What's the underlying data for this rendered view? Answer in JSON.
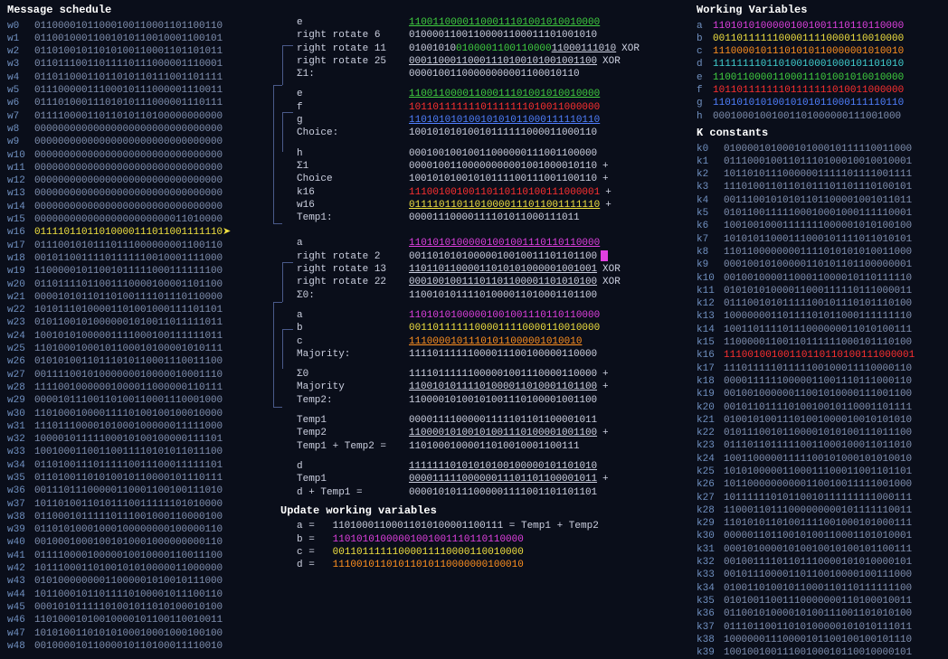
{
  "sections": {
    "message_schedule": "Message schedule",
    "working_vars": "Working Variables",
    "k_constants": "K constants",
    "update": "Update working variables"
  },
  "message_schedule": [
    {
      "label": "w0",
      "bits": "01100001011000100110001101100110"
    },
    {
      "label": "w1",
      "bits": "01100100011001010110010001100101"
    },
    {
      "label": "w2",
      "bits": "01101001011010100110001101101011"
    },
    {
      "label": "w3",
      "bits": "01101110011011110111000001110001"
    },
    {
      "label": "w4",
      "bits": "01101100011011010110111001101111"
    },
    {
      "label": "w5",
      "bits": "01110000011100010111000001110011"
    },
    {
      "label": "w6",
      "bits": "01110100011101010111000001110111"
    },
    {
      "label": "w7",
      "bits": "01111000011011010110100000000000"
    },
    {
      "label": "w8",
      "bits": "00000000000000000000000000000000"
    },
    {
      "label": "w9",
      "bits": "00000000000000000000000000000000"
    },
    {
      "label": "w10",
      "bits": "00000000000000000000000000000000"
    },
    {
      "label": "w11",
      "bits": "00000000000000000000000000000000"
    },
    {
      "label": "w12",
      "bits": "00000000000000000000000000000000"
    },
    {
      "label": "w13",
      "bits": "00000000000000000000000000000000"
    },
    {
      "label": "w14",
      "bits": "00000000000000000000000000000000"
    },
    {
      "label": "w15",
      "bits": "00000000000000000000000011010000"
    },
    {
      "label": "w16",
      "bits": "01111011011010000111011001111110",
      "highlight": true
    },
    {
      "label": "w17",
      "bits": "01110010101110111000000001100110"
    },
    {
      "label": "w18",
      "bits": "00101100111101111110010001111000"
    },
    {
      "label": "w19",
      "bits": "11000001011001011111000111111100"
    },
    {
      "label": "w20",
      "bits": "01101111011001110000100001101100"
    },
    {
      "label": "w21",
      "bits": "00001010110110100111101110110000"
    },
    {
      "label": "w22",
      "bits": "10101110100001101001000111101101"
    },
    {
      "label": "w23",
      "bits": "01011001010000001010011011111011"
    },
    {
      "label": "w24",
      "bits": "10010101000001111000100111111011"
    },
    {
      "label": "w25",
      "bits": "11010001000101100010100001010111"
    },
    {
      "label": "w26",
      "bits": "01010100110111010110001110011100"
    },
    {
      "label": "w27",
      "bits": "00111100101000000010000010001110"
    },
    {
      "label": "w28",
      "bits": "11110010000001000011000000110111"
    },
    {
      "label": "w29",
      "bits": "00001011100110100110001110001000"
    },
    {
      "label": "w30",
      "bits": "11010001000011110100100100010000"
    },
    {
      "label": "w31",
      "bits": "11101110000101000100000011111000"
    },
    {
      "label": "w32",
      "bits": "10000101111100010100100000111101"
    },
    {
      "label": "w33",
      "bits": "10010001100110011110101011011100"
    },
    {
      "label": "w34",
      "bits": "01101001110111110011100011111101"
    },
    {
      "label": "w35",
      "bits": "01101001101010010110000101110111"
    },
    {
      "label": "w36",
      "bits": "00111011100000110001100100111010"
    },
    {
      "label": "w37",
      "bits": "10110100110101110011111101010000"
    },
    {
      "label": "w38",
      "bits": "01100010111110111001000110000100"
    },
    {
      "label": "w39",
      "bits": "01101010001000100000000100000110"
    },
    {
      "label": "w40",
      "bits": "00100010001001010001000000000110"
    },
    {
      "label": "w41",
      "bits": "01111000010000010010000110011100"
    },
    {
      "label": "w42",
      "bits": "10111000110100101010000011000000"
    },
    {
      "label": "w43",
      "bits": "01010000000011000001010010111000"
    },
    {
      "label": "w44",
      "bits": "10110001011011110100001011100110"
    },
    {
      "label": "w45",
      "bits": "00010101111101001011010100010100"
    },
    {
      "label": "w46",
      "bits": "11010001010010000101100110010011"
    },
    {
      "label": "w47",
      "bits": "10101001101010100010001000100100"
    },
    {
      "label": "w48",
      "bits": "00100001011000010110100011110010"
    }
  ],
  "working_variables": [
    {
      "label": "a",
      "bits": "11010101000001001001110110110000",
      "class": "bits-magenta"
    },
    {
      "label": "b",
      "bits": "00110111111000011110000110010000",
      "class": "bits-yellow"
    },
    {
      "label": "c",
      "bits": "11100001011101010110000001010010",
      "class": "bits-orange"
    },
    {
      "label": "d",
      "bits": "11111111011010010001000101101010",
      "class": "bits-cyan"
    },
    {
      "label": "e",
      "bits": "11001100001100011101001010010000",
      "class": "bits-green"
    },
    {
      "label": "f",
      "bits": "10110111111101111111010011000000",
      "class": "bits-red"
    },
    {
      "label": "g",
      "bits": "11010101010010101011000111110110",
      "class": "bits-blue"
    },
    {
      "label": "h",
      "bits": "00010001001001101000000111001000",
      "class": "bits"
    }
  ],
  "k_constants": [
    {
      "label": "k0",
      "bits": "01000010100010100010111110011000"
    },
    {
      "label": "k1",
      "bits": "01110001001101110100010010010001"
    },
    {
      "label": "k2",
      "bits": "10110101110000001111101111001111"
    },
    {
      "label": "k3",
      "bits": "11101001101101011101101110100101"
    },
    {
      "label": "k4",
      "bits": "00111001010101101100001001011011"
    },
    {
      "label": "k5",
      "bits": "01011001111100010001000111110001"
    },
    {
      "label": "k6",
      "bits": "10010010001111111000001010100100"
    },
    {
      "label": "k7",
      "bits": "10101011000111000101111011010101"
    },
    {
      "label": "k8",
      "bits": "11011000000001111010101010011000"
    },
    {
      "label": "k9",
      "bits": "00010010100000110101101100000001"
    },
    {
      "label": "k10",
      "bits": "00100100001100011000010110111110"
    },
    {
      "label": "k11",
      "bits": "01010101000011000111110111000011"
    },
    {
      "label": "k12",
      "bits": "01110010101111100101110101110100"
    },
    {
      "label": "k13",
      "bits": "10000000110111101011000111111110"
    },
    {
      "label": "k14",
      "bits": "10011011110111000000011010100111"
    },
    {
      "label": "k15",
      "bits": "11000001100110111111000101110100"
    },
    {
      "label": "k16",
      "bits": "11100100100110110110100111000001",
      "highlight": true
    },
    {
      "label": "k17",
      "bits": "11101111101111100100011110000110"
    },
    {
      "label": "k18",
      "bits": "00001111110000011001110111000110"
    },
    {
      "label": "k19",
      "bits": "00100100000011001010000111001100"
    },
    {
      "label": "k20",
      "bits": "00101101111010010010110001101111"
    },
    {
      "label": "k21",
      "bits": "01001010011101001000010010101010"
    },
    {
      "label": "k22",
      "bits": "01011100101100001010100111011100"
    },
    {
      "label": "k23",
      "bits": "01110110111110011000100011011010"
    },
    {
      "label": "k24",
      "bits": "10011000001111100101000101010010"
    },
    {
      "label": "k25",
      "bits": "10101000001100011100011001101101"
    },
    {
      "label": "k26",
      "bits": "10110000000000110010011111001000"
    },
    {
      "label": "k27",
      "bits": "10111111010110010111111111000111"
    },
    {
      "label": "k28",
      "bits": "11000110111000000000101111110011"
    },
    {
      "label": "k29",
      "bits": "11010101101001111001000101000111"
    },
    {
      "label": "k30",
      "bits": "00000110110010100110001101010001"
    },
    {
      "label": "k31",
      "bits": "00010100001010010010100101100111"
    },
    {
      "label": "k32",
      "bits": "00100111101101110000101010000101"
    },
    {
      "label": "k33",
      "bits": "00101110000110110010000100111000"
    },
    {
      "label": "k34",
      "bits": "01001101001011000110110111111100"
    },
    {
      "label": "k35",
      "bits": "01010011001110000000110100010011"
    },
    {
      "label": "k36",
      "bits": "01100101000010100111001101010100"
    },
    {
      "label": "k37",
      "bits": "01110110011010100000101010111011"
    },
    {
      "label": "k38",
      "bits": "10000001110000101100100100101110"
    },
    {
      "label": "k39",
      "bits": "10010010011100100010110010000101"
    }
  ],
  "mid": {
    "e": {
      "label": "e",
      "bits": "11001100001100011101001010010000",
      "class": "bits-green"
    },
    "rr6": {
      "label": "right rotate 6",
      "bits": "01000011001100001100011101001010"
    },
    "rr11": {
      "label": "right rotate 11",
      "bits_a": "01001010",
      "bits_b": "0100001100110000",
      "bits_c": "11000111010",
      "op": "XOR"
    },
    "rr25": {
      "label": "right rotate 25",
      "bits": "00011000110001110100101001001100",
      "op": "XOR"
    },
    "sigma1": {
      "label": "Σ1:",
      "bits": "00001001100000000001100010110"
    },
    "e2": {
      "label": "e",
      "bits": "11001100001100011101001010010000",
      "class": "bits-green",
      "underline": true
    },
    "f": {
      "label": "f",
      "bits": "10110111111101111111010011000000",
      "class": "bits-red"
    },
    "g": {
      "label": "g",
      "bits": "11010101010010101011000111110110",
      "class": "bits-blue",
      "underline": true
    },
    "choice_out": {
      "label": "Choice:",
      "bits": "10010101010010111111000011000110"
    },
    "h": {
      "label": "h",
      "bits": "00010010010011000000111001100000",
      "class": "bits"
    },
    "sigma1_use": {
      "label": "Σ1",
      "bits": "00001001100000000001001000010110",
      "op": "+"
    },
    "choice_use": {
      "label": "Choice",
      "bits": "10010101001010111100111001100110",
      "op": "+"
    },
    "k16_use": {
      "label": "k16",
      "bits": "11100100100110110110100111000001",
      "op": "+",
      "class": "bits-red"
    },
    "w16_use": {
      "label": "w16",
      "bits": "01111011011010000111011001111110",
      "op": "+",
      "class": "bits-yellow"
    },
    "temp1": {
      "label": "Temp1:",
      "bits": "00001110000111101011000111011"
    },
    "a": {
      "label": "a",
      "bits": "11010101000001001001110110110000",
      "class": "bits-magenta",
      "underline": true
    },
    "rr2": {
      "label": "right rotate 2",
      "bits": "00110101010000010010011101101100",
      "cursor": true
    },
    "rr13": {
      "label": "right rotate 13",
      "bits": "11011011000011010101000001001001",
      "op": "XOR"
    },
    "rr22": {
      "label": "right rotate 22",
      "bits": "00010010011101101100001101010100",
      "op": "XOR"
    },
    "sigma0": {
      "label": "Σ0:",
      "bits": "11001010111101000011010001101100"
    },
    "a2": {
      "label": "a",
      "bits": "11010101000001001001110110110000",
      "class": "bits-magenta"
    },
    "b": {
      "label": "b",
      "bits": "00110111111000011110000110010000",
      "class": "bits-yellow"
    },
    "c": {
      "label": "c",
      "bits": "11100001011101011000001010010",
      "class": "bits-orange",
      "underline": true
    },
    "majority_out": {
      "label": "Majority:",
      "bits": "11110111111000011100100000110000"
    },
    "sigma0_use": {
      "label": "Σ0",
      "bits": "11110111111000001001110000110000",
      "op": "+"
    },
    "majority_use": {
      "label": "Majority",
      "bits": "11001010111101000011010001101100",
      "op": "+"
    },
    "temp2": {
      "label": "Temp2:",
      "bits": "11000010100101001110100001001100"
    },
    "temp1_use": {
      "label": "Temp1",
      "bits": "00001111000001111101101100001011"
    },
    "temp2_use": {
      "label": "Temp2",
      "bits": "11000010100101001110100001001100",
      "op": "+"
    },
    "t1t2": {
      "label": "Temp1 + Temp2 =",
      "bits": "11010001000011010010001100111"
    },
    "d": {
      "label": "d",
      "bits": "11111110101010100100000101101010",
      "class": "bits-white"
    },
    "temp1_use2": {
      "label": "Temp1",
      "bits": "00001111100000011101101100001011",
      "op": "+"
    },
    "dt1": {
      "label": "d + Temp1 =",
      "bits": "00001010111000001111001101101101"
    }
  },
  "update": {
    "a": {
      "lbl": "a =",
      "bits": "11010001100011010100001100111",
      "suffix": " = Temp1 + Temp2"
    },
    "b": {
      "lbl": "b =",
      "bits": "11010101000001001001110110110000",
      "class": "bits-magenta"
    },
    "c": {
      "lbl": "c =",
      "bits": "00110111111000011110000110010000",
      "class": "bits-yellow"
    },
    "d": {
      "lbl": "d =",
      "bits": "11100101101011010110000000100010",
      "class": "bits-orange"
    }
  },
  "arrow": "➤"
}
